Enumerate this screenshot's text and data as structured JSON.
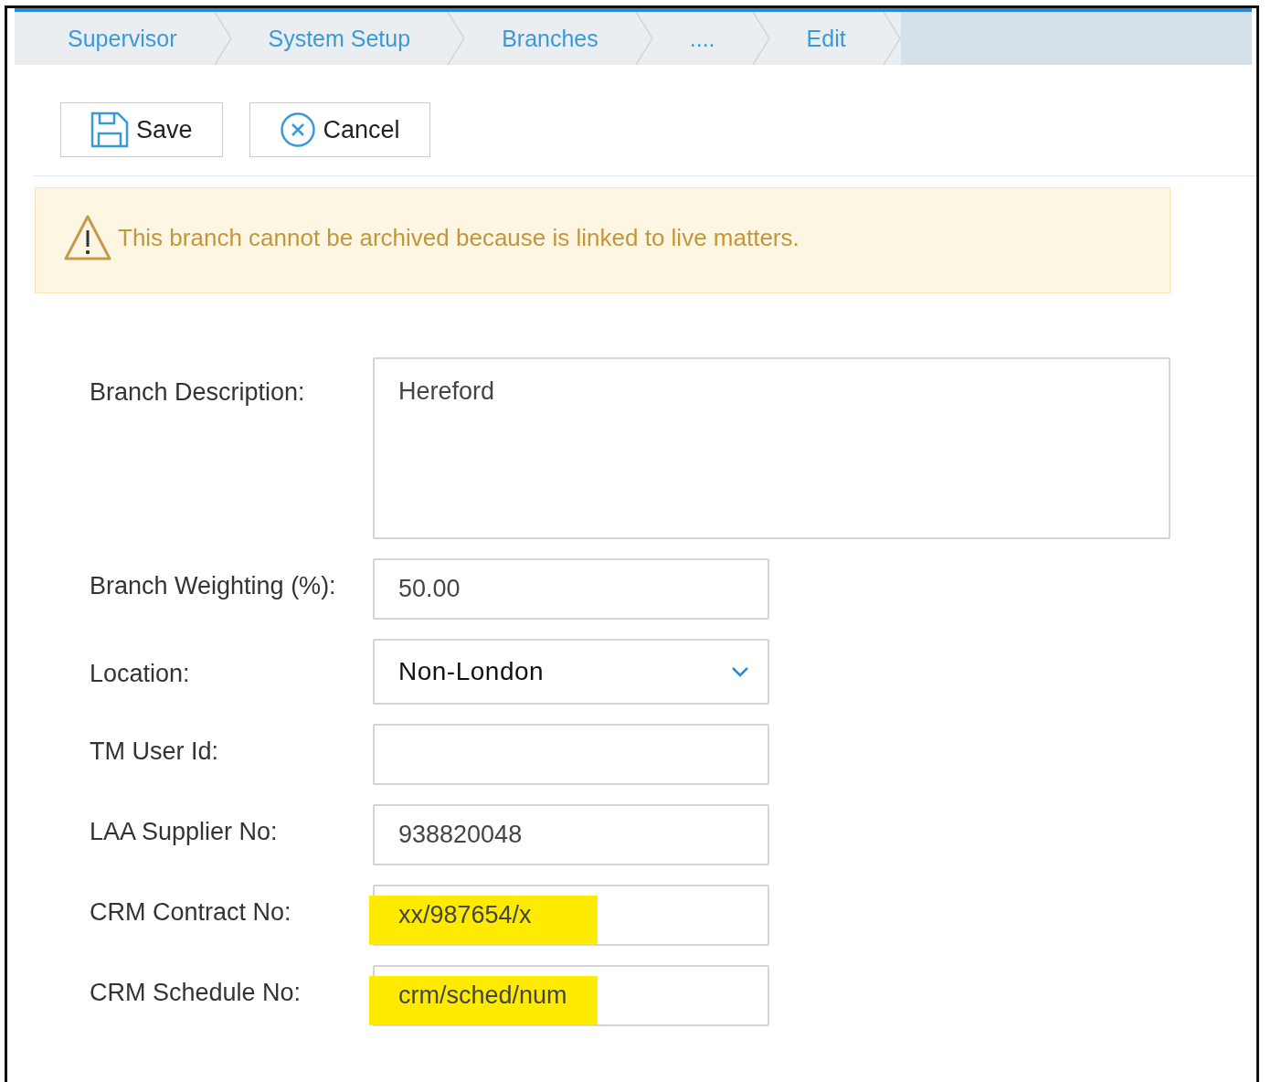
{
  "breadcrumbs": [
    {
      "label": "Supervisor"
    },
    {
      "label": "System Setup"
    },
    {
      "label": "Branches"
    },
    {
      "label": "...."
    },
    {
      "label": "Edit"
    }
  ],
  "toolbar": [
    {
      "label": "Save",
      "kind": "save"
    },
    {
      "label": "Cancel",
      "kind": "cancel"
    }
  ],
  "alert": {
    "message": "This branch cannot be archived because is linked to live matters."
  },
  "fields": [
    {
      "label": "Branch Description:",
      "kind": "textarea",
      "value": "Hereford",
      "highlighted": false
    },
    {
      "label": "Branch Weighting (%):",
      "kind": "text",
      "value": "50.00",
      "highlighted": false
    },
    {
      "label": "Location:",
      "kind": "select",
      "value": "Non-London",
      "highlighted": false
    },
    {
      "label": "TM User Id:",
      "kind": "text",
      "highlighted": false
    },
    {
      "label": "LAA Supplier No:",
      "kind": "text",
      "value": "938820048",
      "highlighted": false
    },
    {
      "label": "CRM Contract No:",
      "kind": "text",
      "value": "xx/987654/x",
      "highlighted": true
    },
    {
      "label": "CRM Schedule No:",
      "kind": "text",
      "value": "crm/sched/num",
      "highlighted": true
    }
  ]
}
